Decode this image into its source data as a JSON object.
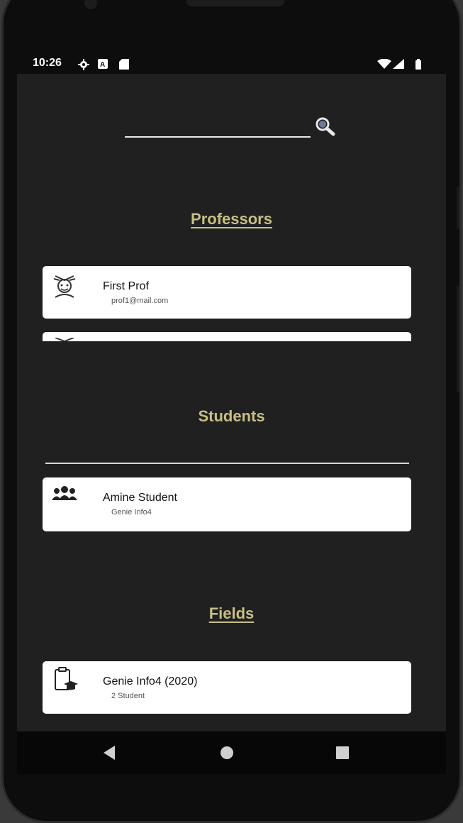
{
  "status_bar": {
    "time": "10:26",
    "icons": [
      "settings-icon",
      "notification-icon",
      "sd-card-icon",
      "wifi-icon",
      "signal-icon",
      "battery-icon"
    ]
  },
  "search": {
    "value": "",
    "placeholder": "",
    "button_icon": "search-icon"
  },
  "sections": {
    "professors": {
      "title": "Professors",
      "items": [
        {
          "name": "First Prof",
          "email": "prof1@mail.com",
          "icon": "professor-icon"
        }
      ]
    },
    "students": {
      "title": "Students",
      "items": [
        {
          "name": "Amine Student",
          "field": "Genie Info4",
          "icon": "students-group-icon"
        }
      ]
    },
    "fields": {
      "title": "Fields",
      "items": [
        {
          "name": "Genie Info4 (2020)",
          "count": "2 Student",
          "icon": "clipboard-graduation-icon"
        }
      ]
    }
  },
  "nav": {
    "back": "back-icon",
    "home": "home-icon",
    "recents": "recents-icon"
  },
  "colors": {
    "background": "#202020",
    "section_title": "#c8bf86",
    "card": "#ffffff"
  }
}
